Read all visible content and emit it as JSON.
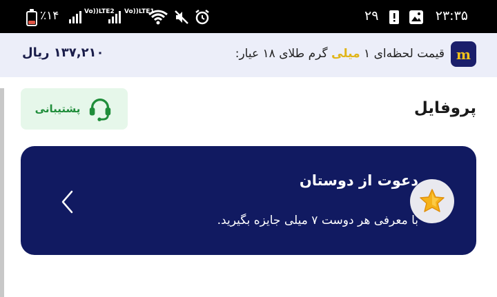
{
  "status_bar": {
    "battery": "٪۱۴",
    "lte1": "LTE2",
    "lte2": "LTE1",
    "volte": "Vo))",
    "date": "۲۹",
    "time": "۲۳:۳۵"
  },
  "price_bar": {
    "prefix": "قیمت لحظه‌ای ۱ ",
    "highlight": "میلی",
    "suffix": " گرم طلای ۱۸ عیار:",
    "value": "۱۳۷,۲۱۰ ریال",
    "logo_letter": "m",
    "highlight_color": "#e0b51a"
  },
  "profile": {
    "title": "پروفایل",
    "support_label": "پشتیبانی"
  },
  "invite": {
    "title": "دعوت از دوستان",
    "subtitle": "با معرفی هر دوست ۷ میلی جایزه بگیرید.",
    "bg_color": "#111a61"
  }
}
